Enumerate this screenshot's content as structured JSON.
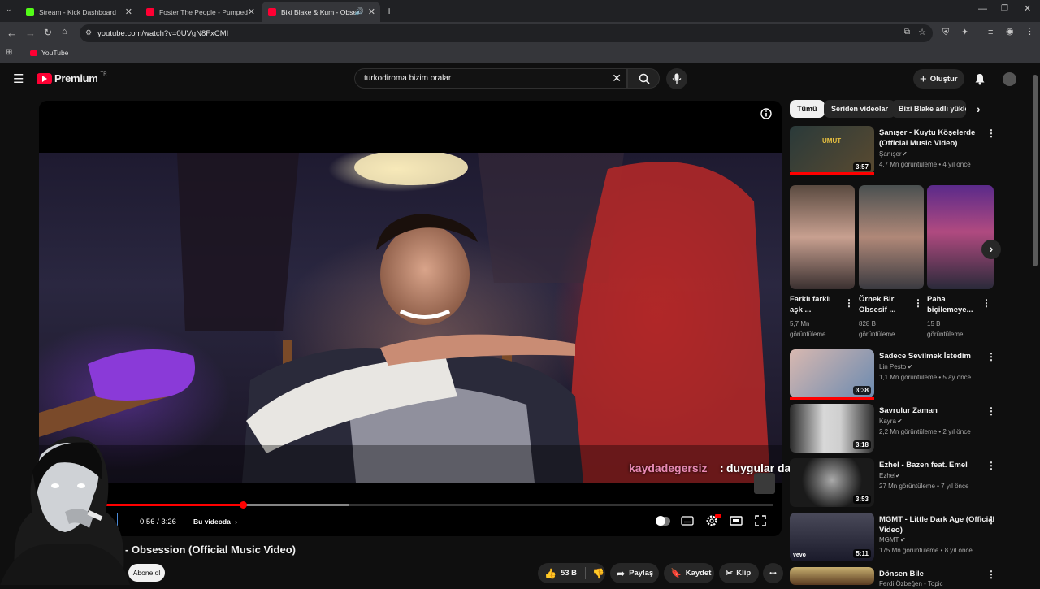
{
  "browser": {
    "tabs": [
      {
        "label": "Stream - Kick Dashboard",
        "favicon_color": "#53fc18"
      },
      {
        "label": "Foster The People - Pumped Up",
        "favicon_color": "#ff0033"
      },
      {
        "label": "Bixi Blake & Kum - Obsessi",
        "favicon_color": "#ff0033"
      }
    ],
    "url": "youtube.com/watch?v=0UVgN8FxCMI",
    "bookmark": "YouTube"
  },
  "header": {
    "logo_text": "Premium",
    "logo_region": "TR",
    "search_value": "turkodiroma bizim oralar",
    "create_label": "Oluştur"
  },
  "player": {
    "time": "0:56 / 3:26",
    "chapter": "Bu videoda",
    "progress_fraction": 0.27,
    "buffered_fraction": 0.415,
    "chat_user": "kaydadegersiz",
    "chat_sep": ":",
    "chat_message": "duygular da keza öyle"
  },
  "video": {
    "title": "- Obsession (Official Music Video)",
    "subscribe_label": "Abone ol",
    "likes": "53 B",
    "share_label": "Paylaş",
    "save_label": "Kaydet",
    "clip_label": "Klip",
    "more_label": "•••"
  },
  "sidebar": {
    "chips": [
      "Tümü",
      "Seriden videolar",
      "Bixi Blake adlı yükleyi"
    ],
    "shorts": [
      {
        "title": "Farklı farklı aşk ...",
        "views": "5,7 Mn",
        "views_suffix": "görüntüleme"
      },
      {
        "title": "Örnek Bir Obsesif ...",
        "views": "828 B",
        "views_suffix": "görüntüleme"
      },
      {
        "title": "Paha biçilemeye...",
        "views": "15 B",
        "views_suffix": "görüntüleme"
      }
    ],
    "videos": [
      {
        "title_1": "Şanışer - Kuytu Köşelerde",
        "title_2": "(Official Music Video)",
        "channel": "Şanışer",
        "meta": "4,7 Mn görüntüleme • 4 yıl önce",
        "duration": "3:57",
        "colors": [
          "#3a4a4a",
          "#6a5a40"
        ]
      },
      {
        "title_1": "Sadece Sevilmek İstedim",
        "title_2": "",
        "channel": "Lin Pesto",
        "meta": "1,1 Mn görüntüleme • 5 ay önce",
        "duration": "3:38",
        "colors": [
          "#d8b8b0",
          "#6a8ab0"
        ]
      },
      {
        "title_1": "Savrulur Zaman",
        "title_2": "",
        "channel": "Kayra",
        "meta": "2,2 Mn görüntüleme • 2 yıl önce",
        "duration": "3:18",
        "colors": [
          "#cfcfcf",
          "#2a2a2a"
        ]
      },
      {
        "title_1": "Ezhel - Bazen feat. Emel",
        "title_2": "",
        "channel": "Ezhel",
        "meta": "27 Mn görüntüleme • 7 yıl önce",
        "duration": "3:53",
        "colors": [
          "#1a1a1a",
          "#888"
        ]
      },
      {
        "title_1": "MGMT - Little Dark Age (Official",
        "title_2": "Video)",
        "channel": "MGMT",
        "meta": "175 Mn görüntüleme • 8 yıl önce",
        "duration": "5:11",
        "colors": [
          "#2a2a3a",
          "#8a8a9a"
        ]
      },
      {
        "title_1": "Dönsen Bile",
        "title_2": "",
        "channel": "Ferdi Özbeğen - Topic",
        "meta": "",
        "duration": "",
        "colors": [
          "#c8b070",
          "#5a3a20"
        ]
      }
    ]
  }
}
